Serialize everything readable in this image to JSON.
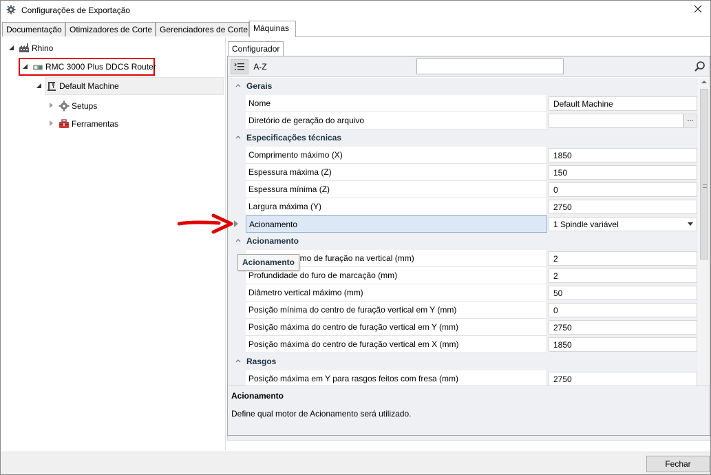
{
  "window": {
    "title": "Configurações de Exportação",
    "icon": "gear-icon",
    "close_icon": "close-icon"
  },
  "tabs": [
    {
      "label": "Documentação",
      "active": false
    },
    {
      "label": "Otimizadores de Corte",
      "active": false
    },
    {
      "label": "Gerenciadores de Corte",
      "active": false
    },
    {
      "label": "Máquinas",
      "active": true
    }
  ],
  "tree": {
    "root": {
      "label": "Rhino",
      "icon": "factory-icon",
      "expanded": true
    },
    "machine": {
      "label": "RMC 3000 Plus DDCS Router",
      "icon": "cnc-router-icon",
      "expanded": true,
      "highlighted": true
    },
    "default": {
      "label": "Default Machine",
      "icon": "machine-icon",
      "expanded": true,
      "selected": true
    },
    "children": [
      {
        "label": "Setups",
        "icon": "gear-icon",
        "expanded": false
      },
      {
        "label": "Ferramentas",
        "icon": "toolbox-icon",
        "expanded": false
      }
    ]
  },
  "configurator": {
    "tab_label": "Configurador",
    "toolbar": {
      "categorized_icon": "categorized-list-icon",
      "az_label": "A-Z",
      "search_placeholder": "",
      "search_icon": "search-icon"
    },
    "categories": [
      {
        "label": "Gerais",
        "properties": [
          {
            "name": "Nome",
            "value": "Default Machine",
            "editor": "text"
          },
          {
            "name": "Diretório de geração do arquivo",
            "value": "",
            "editor": "browse",
            "button": "..."
          }
        ]
      },
      {
        "label": "Especificações técnicas",
        "properties": [
          {
            "name": "Comprimento máximo (X)",
            "value": "1850",
            "editor": "text"
          },
          {
            "name": "Espessura máxima (Z)",
            "value": "150",
            "editor": "text"
          },
          {
            "name": "Espessura mínima (Z)",
            "value": "0",
            "editor": "text"
          },
          {
            "name": "Largura máxima (Y)",
            "value": "2750",
            "editor": "text"
          },
          {
            "name": "Acionamento",
            "value": "1 Spindle variável",
            "editor": "dropdown",
            "selected": true
          }
        ]
      },
      {
        "label": "Acionamento",
        "properties": [
          {
            "name": "Diâmetro mínimo de furação na vertical (mm)",
            "value": "2",
            "editor": "text"
          },
          {
            "name": "Profundidade do furo de marcação (mm)",
            "value": "2",
            "editor": "text"
          },
          {
            "name": "Diâmetro vertical máximo (mm)",
            "value": "50",
            "editor": "text"
          },
          {
            "name": "Posição mínima do centro de furação vertical em Y (mm)",
            "value": "0",
            "editor": "text"
          },
          {
            "name": "Posição máxima do centro de furação vertical em Y (mm)",
            "value": "2750",
            "editor": "text"
          },
          {
            "name": "Posição máxima do centro de furação vertical em X (mm)",
            "value": "1850",
            "editor": "text"
          }
        ]
      },
      {
        "label": "Rasgos",
        "properties": [
          {
            "name": "Posição máxima em Y para rasgos feitos com fresa (mm)",
            "value": "2750",
            "editor": "text"
          }
        ]
      }
    ],
    "tooltip": "Acionamento",
    "description": {
      "title": "Acionamento",
      "text": "Define qual motor de Acionamento será utilizado."
    }
  },
  "footer": {
    "close_label": "Fechar"
  },
  "annotation": {
    "arrow_icon": "red-arrow-icon",
    "arrow_color": "#e00000",
    "highlight_color": "#e00000"
  }
}
